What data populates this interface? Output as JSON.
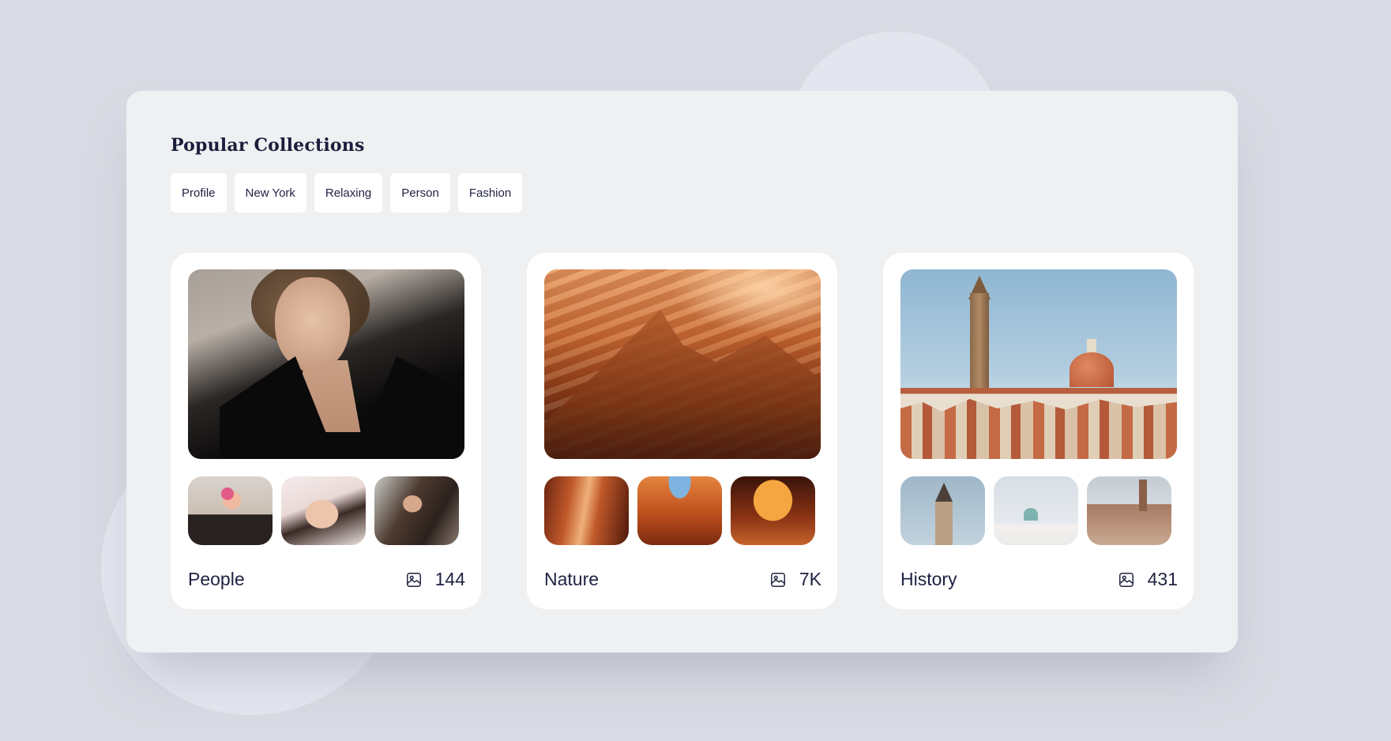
{
  "section": {
    "title": "Popular Collections"
  },
  "tags": [
    "Profile",
    "New York",
    "Relaxing",
    "Person",
    "Fashion"
  ],
  "collections": [
    {
      "name": "People",
      "count": "144",
      "icon": "image-icon",
      "images": [
        "woman-black-blazer",
        "woman-pink-flower",
        "woman-floral-shirt",
        "woman-dark-hair"
      ]
    },
    {
      "name": "Nature",
      "count": "7K",
      "icon": "image-icon",
      "images": [
        "canyon-waves",
        "canyon-light-beam",
        "canyon-sky-opening",
        "canyon-orange-glow"
      ]
    },
    {
      "name": "History",
      "count": "431",
      "icon": "image-icon",
      "images": [
        "florence-skyline",
        "church-spire",
        "white-mosque",
        "old-brick-building"
      ]
    }
  ],
  "colors": {
    "background": "#d8dbe3",
    "panel": "#eff0f2",
    "card": "#ffffff",
    "text": "#1f2240"
  }
}
